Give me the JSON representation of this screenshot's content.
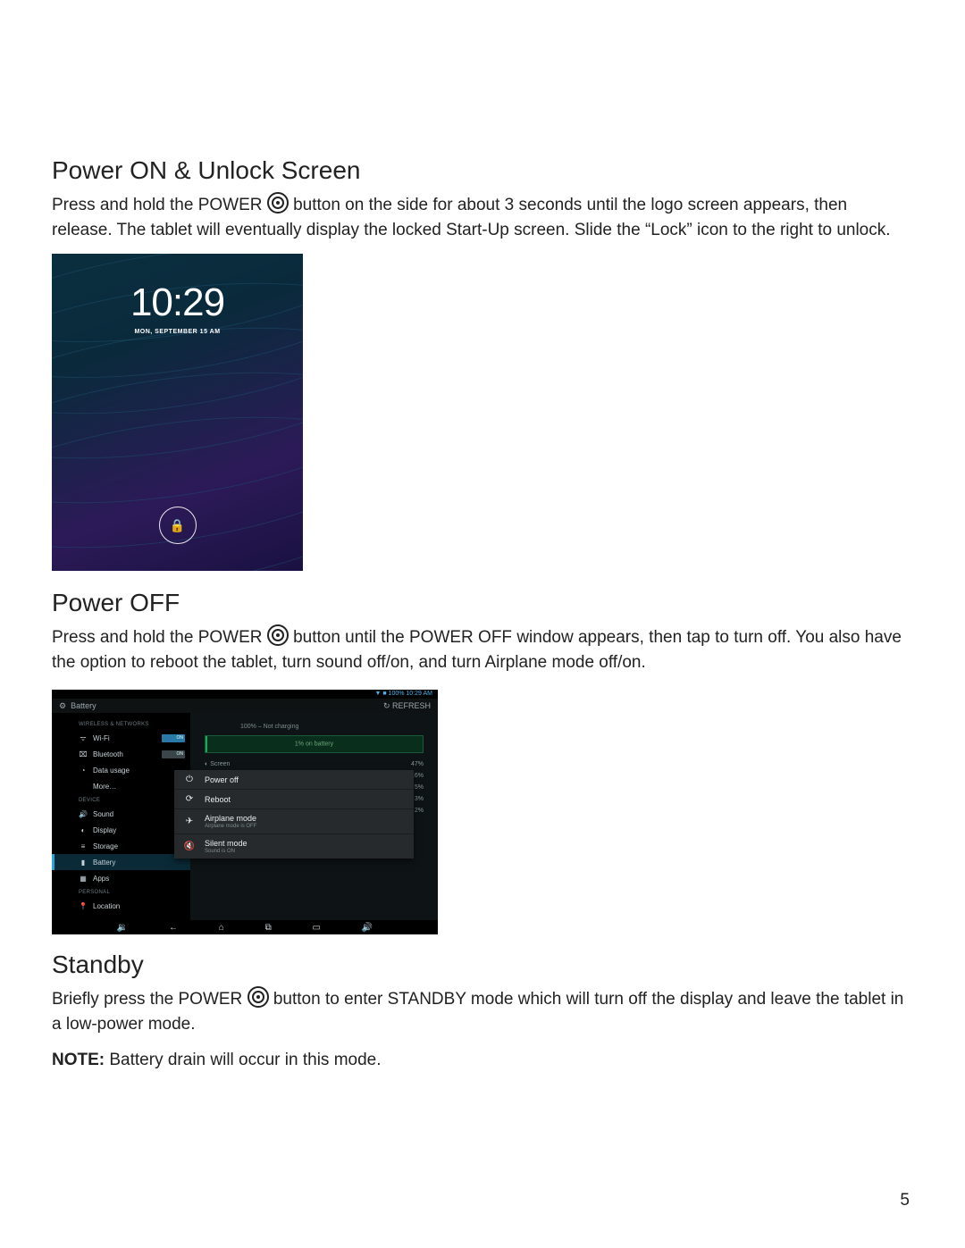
{
  "page_number": "5",
  "sections": {
    "power_on": {
      "title": "Power ON & Unlock Screen",
      "body_pre": "Press and hold the POWER ",
      "body_post": " button on the side for about 3 seconds until the logo screen appears, then release. The tablet will  eventually display the locked Start-Up screen. Slide the “Lock” icon to the right to unlock."
    },
    "power_off": {
      "title": "Power OFF",
      "body_pre": "Press and hold the POWER ",
      "body_post": " button until the POWER OFF window appears, then tap to turn off. You also have the option to reboot the tablet, turn sound off/on, and turn Airplane mode off/on."
    },
    "standby": {
      "title": "Standby",
      "body_pre": "Briefly press the POWER ",
      "body_post": " button to enter STANDBY mode which will turn off the display and leave the tablet in a low-power mode.",
      "note_label": "NOTE:",
      "note_body": " Battery drain will occur in this mode."
    }
  },
  "lockscreen": {
    "time": "10:29",
    "date": "MON, SEPTEMBER 15 AM"
  },
  "settings": {
    "status_right": "▼ ■ 100%  10:29 AM",
    "title": "Battery",
    "refresh": "↻ REFRESH",
    "sidebar": {
      "cat1": "WIRELESS & NETWORKS",
      "wifi": "Wi-Fi",
      "wifi_toggle": "ON",
      "bt": "Bluetooth",
      "bt_toggle": "ON",
      "data": "Data usage",
      "more": "More…",
      "cat2": "DEVICE",
      "sound": "Sound",
      "display": "Display",
      "storage": "Storage",
      "battery": "Battery",
      "apps": "Apps",
      "cat3": "PERSONAL",
      "location": "Location"
    },
    "content": {
      "charging": "100% – Not charging",
      "bat_btn": "1% on battery",
      "screen_label": "Screen",
      "screen_pct": "47%",
      "r2_pct": "16%",
      "r3_pct": "5%",
      "r4_pct": "3%",
      "r5_pct": "2%"
    },
    "power_menu": {
      "power_off": "Power off",
      "reboot": "Reboot",
      "airplane": "Airplane mode",
      "airplane_sub": "Airplane mode is OFF",
      "silent": "Silent mode",
      "silent_sub": "Sound is ON"
    }
  }
}
